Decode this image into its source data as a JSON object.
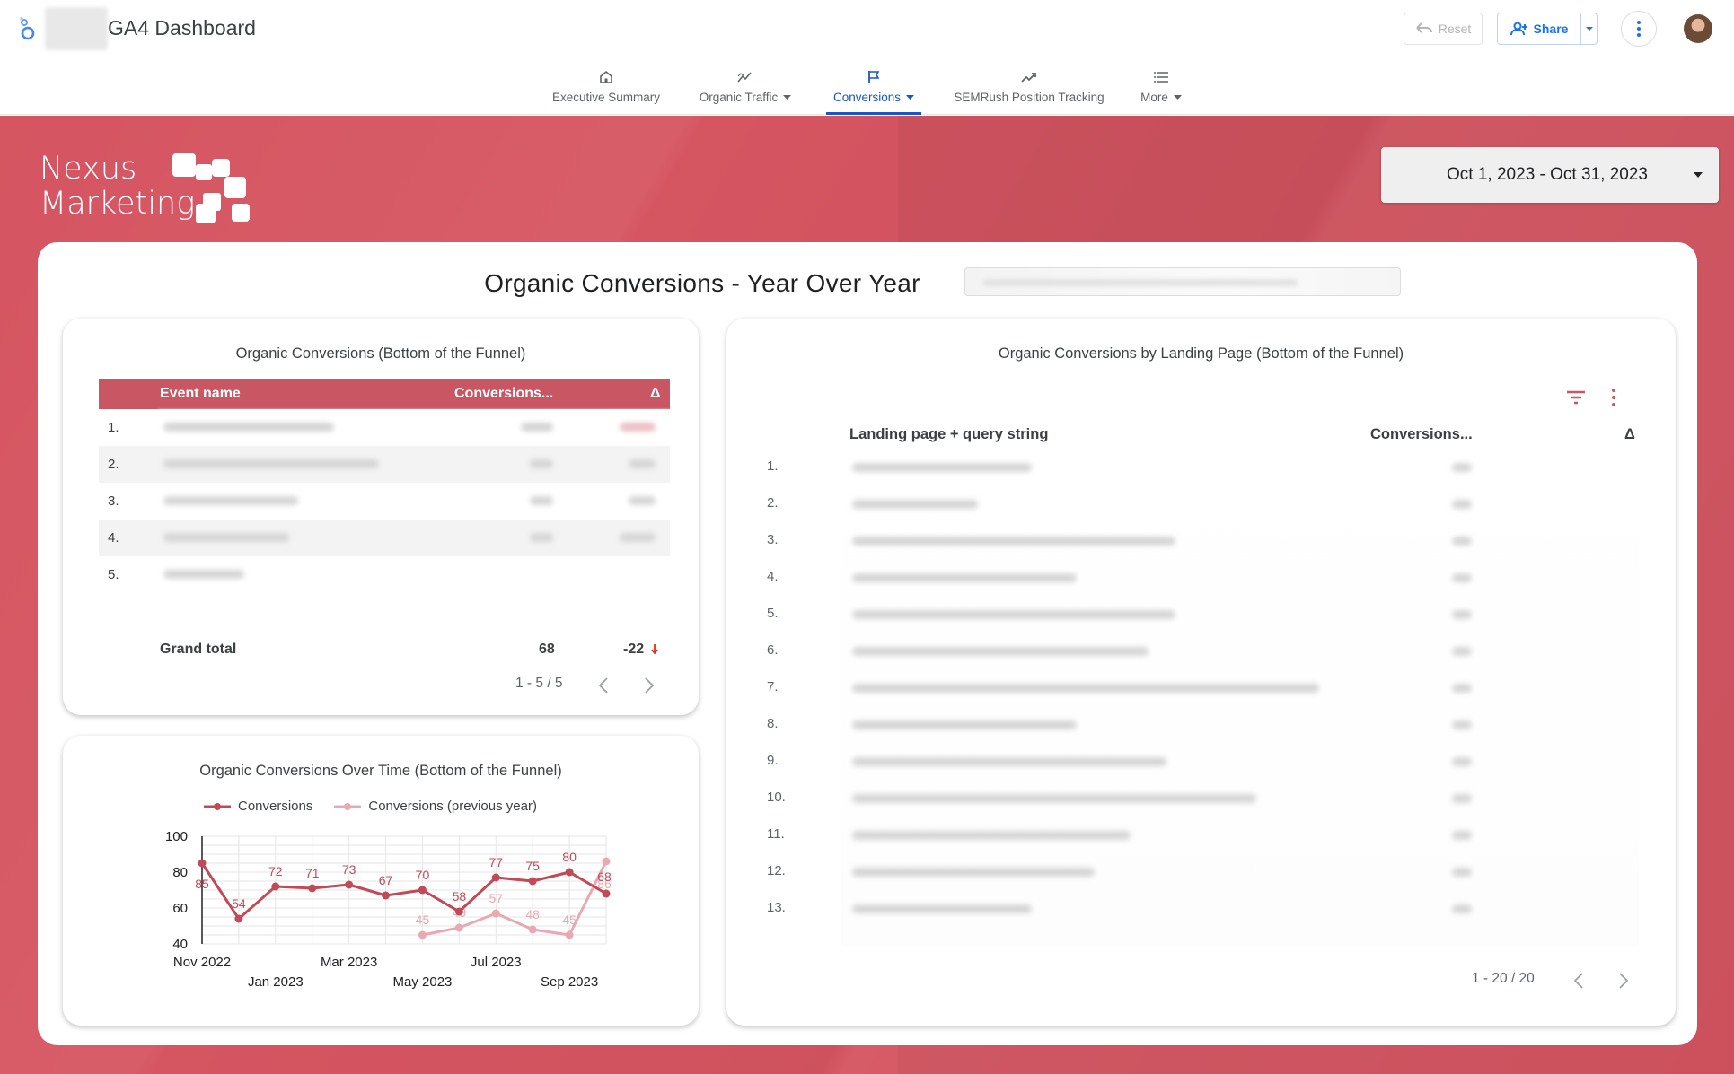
{
  "app": {
    "title": "GA4 Dashboard",
    "reset_label": "Reset",
    "share_label": "Share"
  },
  "nav": {
    "items": [
      {
        "label": "Executive Summary",
        "icon": "home-icon",
        "dropdown": false,
        "active": false
      },
      {
        "label": "Organic Traffic",
        "icon": "trend-icon",
        "dropdown": true,
        "active": false
      },
      {
        "label": "Conversions",
        "icon": "flag-icon",
        "dropdown": true,
        "active": true
      },
      {
        "label": "SEMRush Position Tracking",
        "icon": "trending-up-icon",
        "dropdown": false,
        "active": false
      },
      {
        "label": "More",
        "icon": "list-icon",
        "dropdown": true,
        "active": false
      }
    ]
  },
  "brand": {
    "line1": "Nexus",
    "line2": "Marketing"
  },
  "date_range": {
    "value": "Oct 1, 2023 - Oct 31, 2023"
  },
  "main": {
    "title": "Organic Conversions - Year Over Year"
  },
  "card_events": {
    "title": "Organic Conversions (Bottom of the Funnel)",
    "columns": [
      "Event name",
      "Conversions...",
      "Δ"
    ],
    "row_numbers": [
      "1.",
      "2.",
      "3.",
      "4.",
      "5."
    ],
    "grand_total_label": "Grand total",
    "grand_total_value": "68",
    "grand_total_delta": "-22",
    "pager": "1 - 5 / 5"
  },
  "card_chart": {
    "title": "Organic Conversions Over Time (Bottom of the Funnel)",
    "legend": [
      "Conversions",
      "Conversions (previous year)"
    ]
  },
  "card_landing": {
    "title": "Organic Conversions by Landing Page (Bottom of the Funnel)",
    "columns": [
      "Landing page + query string",
      "Conversions...",
      "Δ"
    ],
    "row_numbers": [
      "1.",
      "2.",
      "3.",
      "4.",
      "5.",
      "6.",
      "7.",
      "8.",
      "9.",
      "10.",
      "11.",
      "12.",
      "13."
    ],
    "pager": "1 - 20 / 20"
  },
  "colors": {
    "brand": "#d55561",
    "series_current": "#c04a57",
    "series_previous": "#e8a9b3",
    "accent_blue": "#1a56c8"
  },
  "chart_data": {
    "type": "line",
    "title": "Organic Conversions Over Time (Bottom of the Funnel)",
    "x": [
      "Nov 2022",
      "Dec 2022",
      "Jan 2023",
      "Feb 2023",
      "Mar 2023",
      "Apr 2023",
      "May 2023",
      "Jun 2023",
      "Jul 2023",
      "Aug 2023",
      "Sep 2023",
      "Oct 2023"
    ],
    "x_tick_labels": [
      "Nov 2022",
      "Jan 2023",
      "Mar 2023",
      "May 2023",
      "Jul 2023",
      "Sep 2023"
    ],
    "series": [
      {
        "name": "Conversions",
        "values": [
          85,
          54,
          72,
          71,
          73,
          67,
          70,
          58,
          77,
          75,
          80,
          68
        ]
      },
      {
        "name": "Conversions (previous year)",
        "values": [
          null,
          null,
          null,
          null,
          null,
          null,
          45,
          49,
          57,
          48,
          45,
          86
        ]
      }
    ],
    "ylim": [
      40,
      100
    ],
    "yticks": [
      40,
      60,
      80,
      100
    ],
    "grid": true,
    "legend_position": "top"
  }
}
